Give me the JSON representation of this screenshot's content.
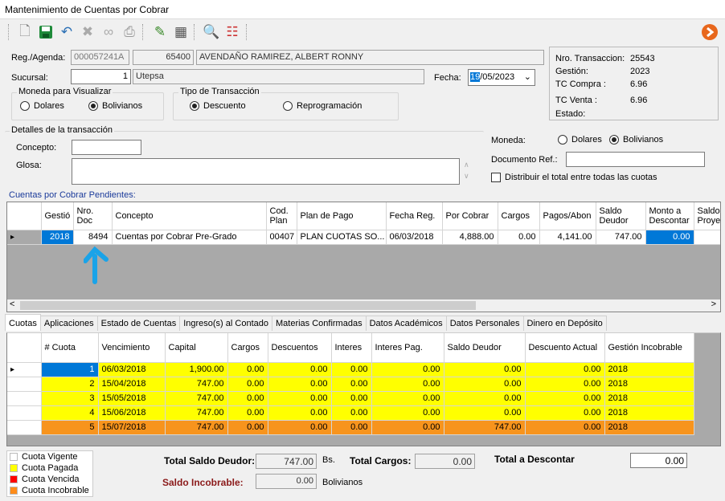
{
  "title": "Mantenimiento de Cuentas por Cobrar",
  "toolbar": {
    "icons": [
      "new-icon",
      "save-icon",
      "undo-icon",
      "delete-icon",
      "link-icon",
      "print-icon",
      "edit-icon",
      "calculator-icon",
      "preview-icon",
      "report-icon",
      "next-icon"
    ]
  },
  "header": {
    "reg_label": "Reg./Agenda:",
    "reg_code": "000057241A",
    "reg_num": "65400",
    "reg_name": "AVENDAÑO RAMIREZ, ALBERT RONNY",
    "sucursal_label": "Sucursal:",
    "sucursal_num": "1",
    "sucursal_name": "Utepsa",
    "fecha_label": "Fecha:",
    "fecha_sel": "19",
    "fecha_rest": "/05/2023",
    "moneda_group": "Moneda para Visualizar",
    "dolares": "Dolares",
    "bolivianos": "Bolivianos",
    "tipo_group": "Tipo de Transacción",
    "descuento": "Descuento",
    "reprogramacion": "Reprogramación"
  },
  "info": {
    "nro_label": "Nro. Transaccion:",
    "nro": "25543",
    "gestion_label": "Gestión:",
    "gestion": "2023",
    "tcc_label": "TC Compra :",
    "tcc": "6.96",
    "tcv_label": "TC Venta :",
    "tcv": "6.96",
    "estado_label": "Estado:"
  },
  "details": {
    "group": "Detalles de la transacción",
    "concepto_label": "Concepto:",
    "glosa_label": "Glosa:",
    "moneda_label": "Moneda:",
    "dolares": "Dolares",
    "bolivianos": "Bolivianos",
    "docref_label": "Documento Ref.:",
    "distribuir": "Distribuir el total entre todas las cuotas"
  },
  "cuentas": {
    "title": "Cuentas por Cobrar Pendientes:",
    "headers": [
      "Gestió",
      "Nro. Doc",
      "Concepto",
      "Cod. Plan",
      "Plan de Pago",
      "Fecha Reg.",
      "Por Cobrar",
      "Cargos",
      "Pagos/Abon",
      "Saldo Deudor",
      "Monto a Descontar",
      "Saldo Proye"
    ],
    "rows": [
      [
        "2018",
        "8494",
        "Cuentas por Cobrar Pre-Grado",
        "00407",
        "PLAN CUOTAS SO...",
        "06/03/2018",
        "4,888.00",
        "0.00",
        "4,141.00",
        "747.00",
        "0.00",
        ""
      ]
    ]
  },
  "tabs": [
    "Cuotas",
    "Aplicaciones",
    "Estado de Cuentas",
    "Ingreso(s) al Contado",
    "Materias Confirmadas",
    "Datos Académicos",
    "Datos Personales",
    "Dinero en Depósito"
  ],
  "cuotas": {
    "headers": [
      "# Cuota",
      "Vencimiento",
      "Capital",
      "Cargos",
      "Descuentos",
      "Interes",
      "Interes Pag.",
      "Saldo Deudor",
      "Descuento Actual",
      "Gestión Incobrable"
    ],
    "rows": [
      {
        "cells": [
          "1",
          "06/03/2018",
          "1,900.00",
          "0.00",
          "0.00",
          "0.00",
          "0.00",
          "0.00",
          "0.00",
          "2018"
        ],
        "status": "pagada"
      },
      {
        "cells": [
          "2",
          "15/04/2018",
          "747.00",
          "0.00",
          "0.00",
          "0.00",
          "0.00",
          "0.00",
          "0.00",
          "2018"
        ],
        "status": "pagada"
      },
      {
        "cells": [
          "3",
          "15/05/2018",
          "747.00",
          "0.00",
          "0.00",
          "0.00",
          "0.00",
          "0.00",
          "0.00",
          "2018"
        ],
        "status": "pagada"
      },
      {
        "cells": [
          "4",
          "15/06/2018",
          "747.00",
          "0.00",
          "0.00",
          "0.00",
          "0.00",
          "0.00",
          "0.00",
          "2018"
        ],
        "status": "pagada"
      },
      {
        "cells": [
          "5",
          "15/07/2018",
          "747.00",
          "0.00",
          "0.00",
          "0.00",
          "0.00",
          "747.00",
          "0.00",
          "2018"
        ],
        "status": "incobrable"
      }
    ]
  },
  "legend": [
    {
      "label": "Cuota Vigente",
      "color": "#ffffff"
    },
    {
      "label": "Cuota Pagada",
      "color": "#ffff00"
    },
    {
      "label": "Cuota Vencida",
      "color": "#ff0000"
    },
    {
      "label": "Cuota Incobrable",
      "color": "#ff8c1a"
    }
  ],
  "totals": {
    "saldo_label": "Total Saldo Deudor:",
    "saldo": "747.00",
    "bs": "Bs.",
    "cargos_label": "Total Cargos:",
    "cargos": "0.00",
    "descontar_label": "Total a Descontar",
    "descontar": "0.00",
    "incobrable_label": "Saldo Incobrable:",
    "incobrable": "0.00",
    "bolivianos": "Bolivianos"
  },
  "colors": {
    "pagada": "#ffff00",
    "incobrable": "#f7941d",
    "selected": "#0078d7",
    "arrow": "#1aa3e8",
    "incobrable_label": "#8b1a1a"
  }
}
